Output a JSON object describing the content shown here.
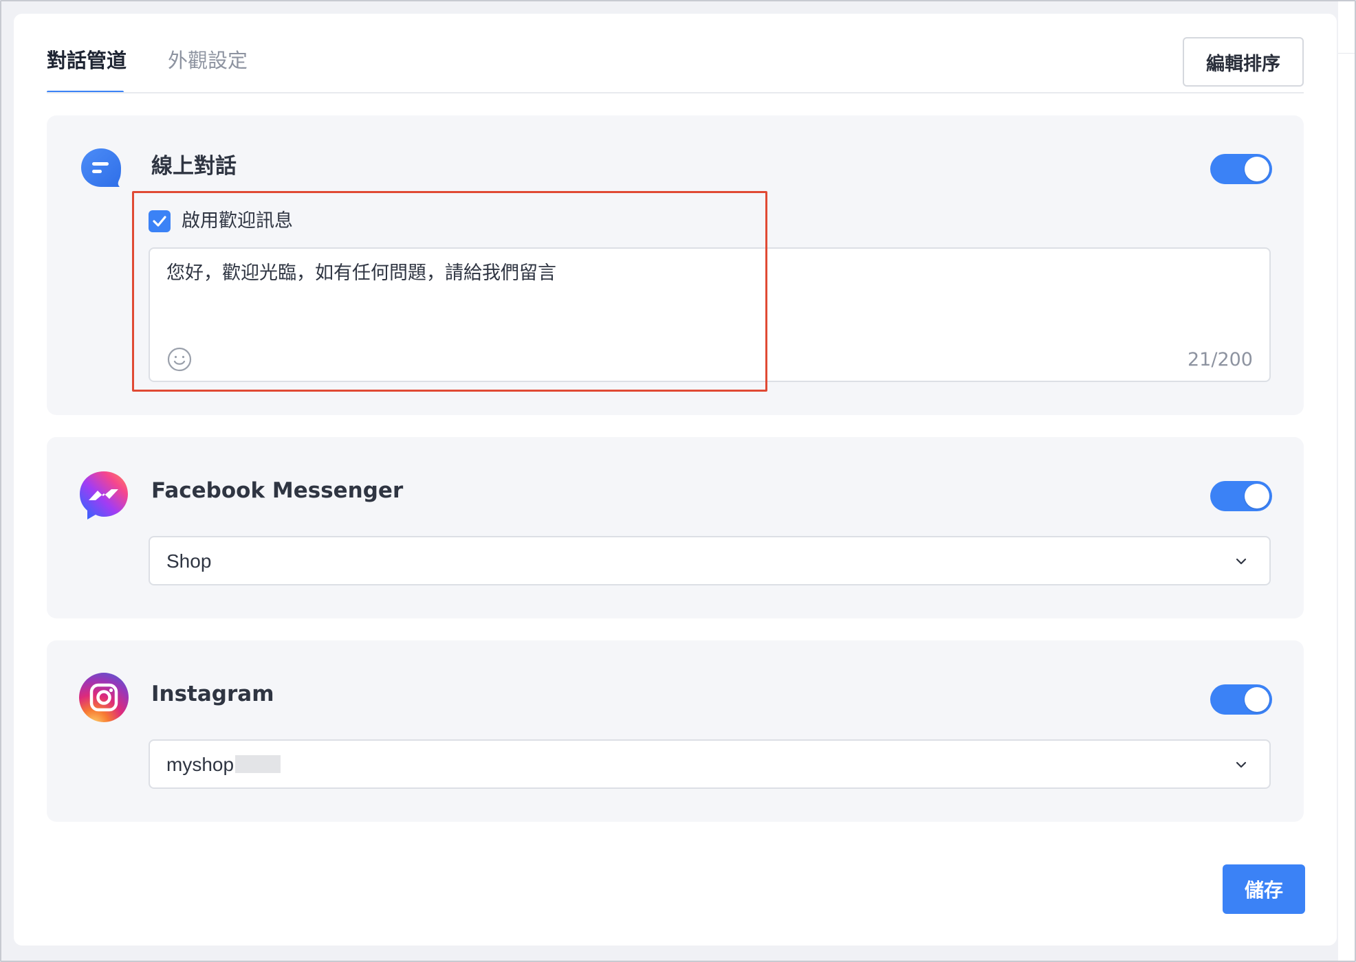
{
  "tabs": [
    {
      "label": "對話管道",
      "active": true
    },
    {
      "label": "外觀設定",
      "active": false
    }
  ],
  "edit_sort_label": "編輯排序",
  "channels": {
    "live_chat": {
      "title": "線上對話",
      "icon": "chat-bubble-icon",
      "enabled": true,
      "welcome": {
        "checkbox_label": "啟用歡迎訊息",
        "checked": true,
        "message": "您好，歡迎光臨，如有任何問題，請給我們留言",
        "char_count": "21/200"
      }
    },
    "messenger": {
      "title": "Facebook Messenger",
      "icon": "messenger-icon",
      "enabled": true,
      "selected": "Shop"
    },
    "instagram": {
      "title": "Instagram",
      "icon": "instagram-icon",
      "enabled": true,
      "selected": "myshop"
    }
  },
  "save_label": "儲存",
  "colors": {
    "accent": "#3b82f6",
    "highlight": "#e04a34",
    "panel_bg": "#f5f6f9"
  }
}
